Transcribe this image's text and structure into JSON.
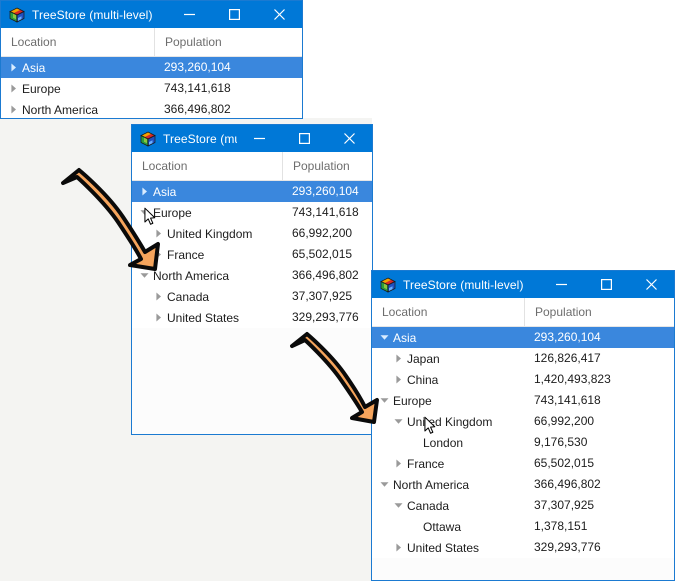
{
  "app": {
    "title": "TreeStore (multi-level)",
    "icon": "cube-icon",
    "accent_titlebar": "#0078d7",
    "accent_selection": "#3a87dd",
    "border": "#1b7ad1",
    "arrow_fill": "#f5a45c",
    "arrow_stroke": "#000000",
    "canvas_bg": "#f4f4f2"
  },
  "window_controls": {
    "minimize": "—",
    "maximize": "☐",
    "close": "✕",
    "minimize_name": "minimize-button",
    "maximize_name": "maximize-button",
    "close_name": "close-button"
  },
  "columns": [
    {
      "label": "Location"
    },
    {
      "label": "Population"
    }
  ],
  "windows": [
    {
      "id": "window-1",
      "title": "TreeStore (multi-level)",
      "rows": [
        {
          "label": "Asia",
          "population": "293,260,104",
          "depth": 0,
          "state": "collapsed",
          "selected": true
        },
        {
          "label": "Europe",
          "population": "743,141,618",
          "depth": 0,
          "state": "collapsed",
          "selected": false
        },
        {
          "label": "North America",
          "population": "366,496,802",
          "depth": 0,
          "state": "collapsed",
          "selected": false
        }
      ]
    },
    {
      "id": "window-2",
      "title": "TreeStore (multi-level)",
      "rows": [
        {
          "label": "Asia",
          "population": "293,260,104",
          "depth": 0,
          "state": "collapsed",
          "selected": true
        },
        {
          "label": "Europe",
          "population": "743,141,618",
          "depth": 0,
          "state": "expanded",
          "selected": false
        },
        {
          "label": "United Kingdom",
          "population": "66,992,200",
          "depth": 1,
          "state": "collapsed",
          "selected": false
        },
        {
          "label": "France",
          "population": "65,502,015",
          "depth": 1,
          "state": "collapsed",
          "selected": false
        },
        {
          "label": "North America",
          "population": "366,496,802",
          "depth": 0,
          "state": "expanded",
          "selected": false
        },
        {
          "label": "Canada",
          "population": "37,307,925",
          "depth": 1,
          "state": "collapsed",
          "selected": false
        },
        {
          "label": "United States",
          "population": "329,293,776",
          "depth": 1,
          "state": "collapsed",
          "selected": false
        }
      ]
    },
    {
      "id": "window-3",
      "title": "TreeStore (multi-level)",
      "rows": [
        {
          "label": "Asia",
          "population": "293,260,104",
          "depth": 0,
          "state": "expanded",
          "selected": true
        },
        {
          "label": "Japan",
          "population": "126,826,417",
          "depth": 1,
          "state": "collapsed",
          "selected": false
        },
        {
          "label": "China",
          "population": "1,420,493,823",
          "depth": 1,
          "state": "collapsed",
          "selected": false
        },
        {
          "label": "Europe",
          "population": "743,141,618",
          "depth": 0,
          "state": "expanded",
          "selected": false
        },
        {
          "label": "United Kingdom",
          "population": "66,992,200",
          "depth": 1,
          "state": "expanded",
          "selected": false
        },
        {
          "label": "London",
          "population": "9,176,530",
          "depth": 2,
          "state": "leaf",
          "selected": false
        },
        {
          "label": "France",
          "population": "65,502,015",
          "depth": 1,
          "state": "collapsed",
          "selected": false
        },
        {
          "label": "North America",
          "population": "366,496,802",
          "depth": 0,
          "state": "expanded",
          "selected": false
        },
        {
          "label": "Canada",
          "population": "37,307,925",
          "depth": 1,
          "state": "expanded",
          "selected": false
        },
        {
          "label": "Ottawa",
          "population": "1,378,151",
          "depth": 2,
          "state": "leaf",
          "selected": false
        },
        {
          "label": "United States",
          "population": "329,293,776",
          "depth": 1,
          "state": "collapsed",
          "selected": false
        }
      ]
    }
  ],
  "annotations": [
    {
      "name": "flow-arrow-1",
      "from": "window-1",
      "to": "window-2"
    },
    {
      "name": "flow-arrow-2",
      "from": "window-2",
      "to": "window-3"
    }
  ],
  "cursors": [
    {
      "name": "mouse-cursor-window-2",
      "target": "Europe expander"
    },
    {
      "name": "mouse-cursor-window-3",
      "target": "United Kingdom expander"
    }
  ]
}
